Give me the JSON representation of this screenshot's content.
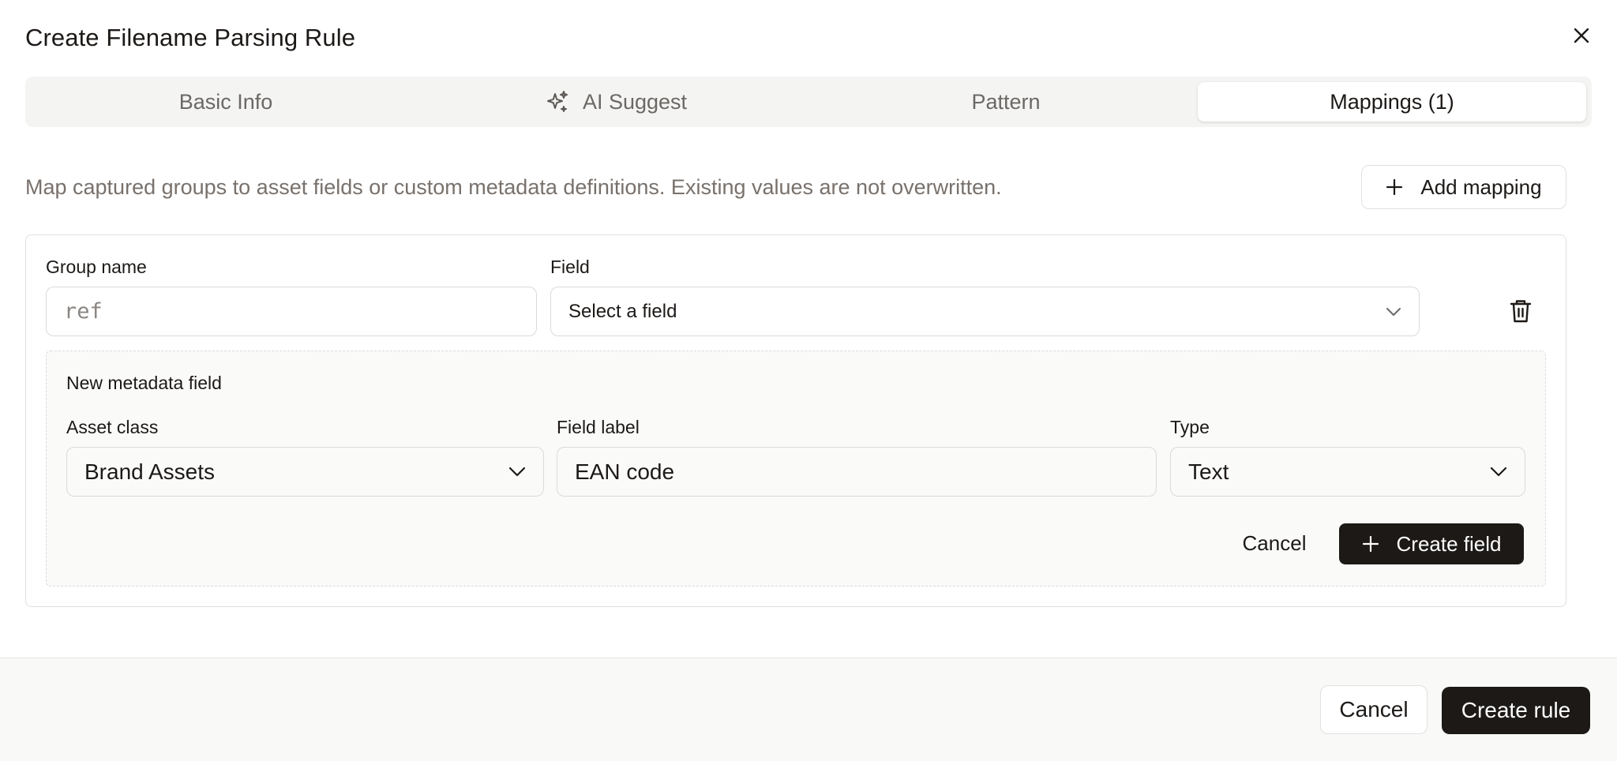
{
  "dialog": {
    "title": "Create Filename Parsing Rule",
    "close_icon": "close-icon"
  },
  "tabs": [
    {
      "label": "Basic Info",
      "active": false
    },
    {
      "label": "AI Suggest",
      "icon": "sparkles-icon",
      "active": false
    },
    {
      "label": "Pattern",
      "active": false
    },
    {
      "label": "Mappings (1)",
      "active": true
    }
  ],
  "mappings": {
    "description": "Map captured groups to asset fields or custom metadata definitions. Existing values are not overwritten.",
    "add_button_label": "Add mapping",
    "add_button_icon": "plus-icon",
    "row": {
      "group_name_label": "Group name",
      "group_name_value": "ref",
      "field_label": "Field",
      "field_value": "Select a field",
      "delete_icon": "trash-icon"
    },
    "new_field": {
      "heading": "New metadata field",
      "asset_class_label": "Asset class",
      "asset_class_value": "Brand Assets",
      "field_label_label": "Field label",
      "field_label_value": "EAN code",
      "type_label": "Type",
      "type_value": "Text",
      "cancel_label": "Cancel",
      "create_label": "Create field"
    }
  },
  "footer": {
    "cancel_label": "Cancel",
    "create_label": "Create rule"
  },
  "colors": {
    "primary_dark": "#1c1917",
    "muted_text": "#78716c",
    "border": "#e2e0de",
    "tabs_bg": "#f4f4f3"
  }
}
